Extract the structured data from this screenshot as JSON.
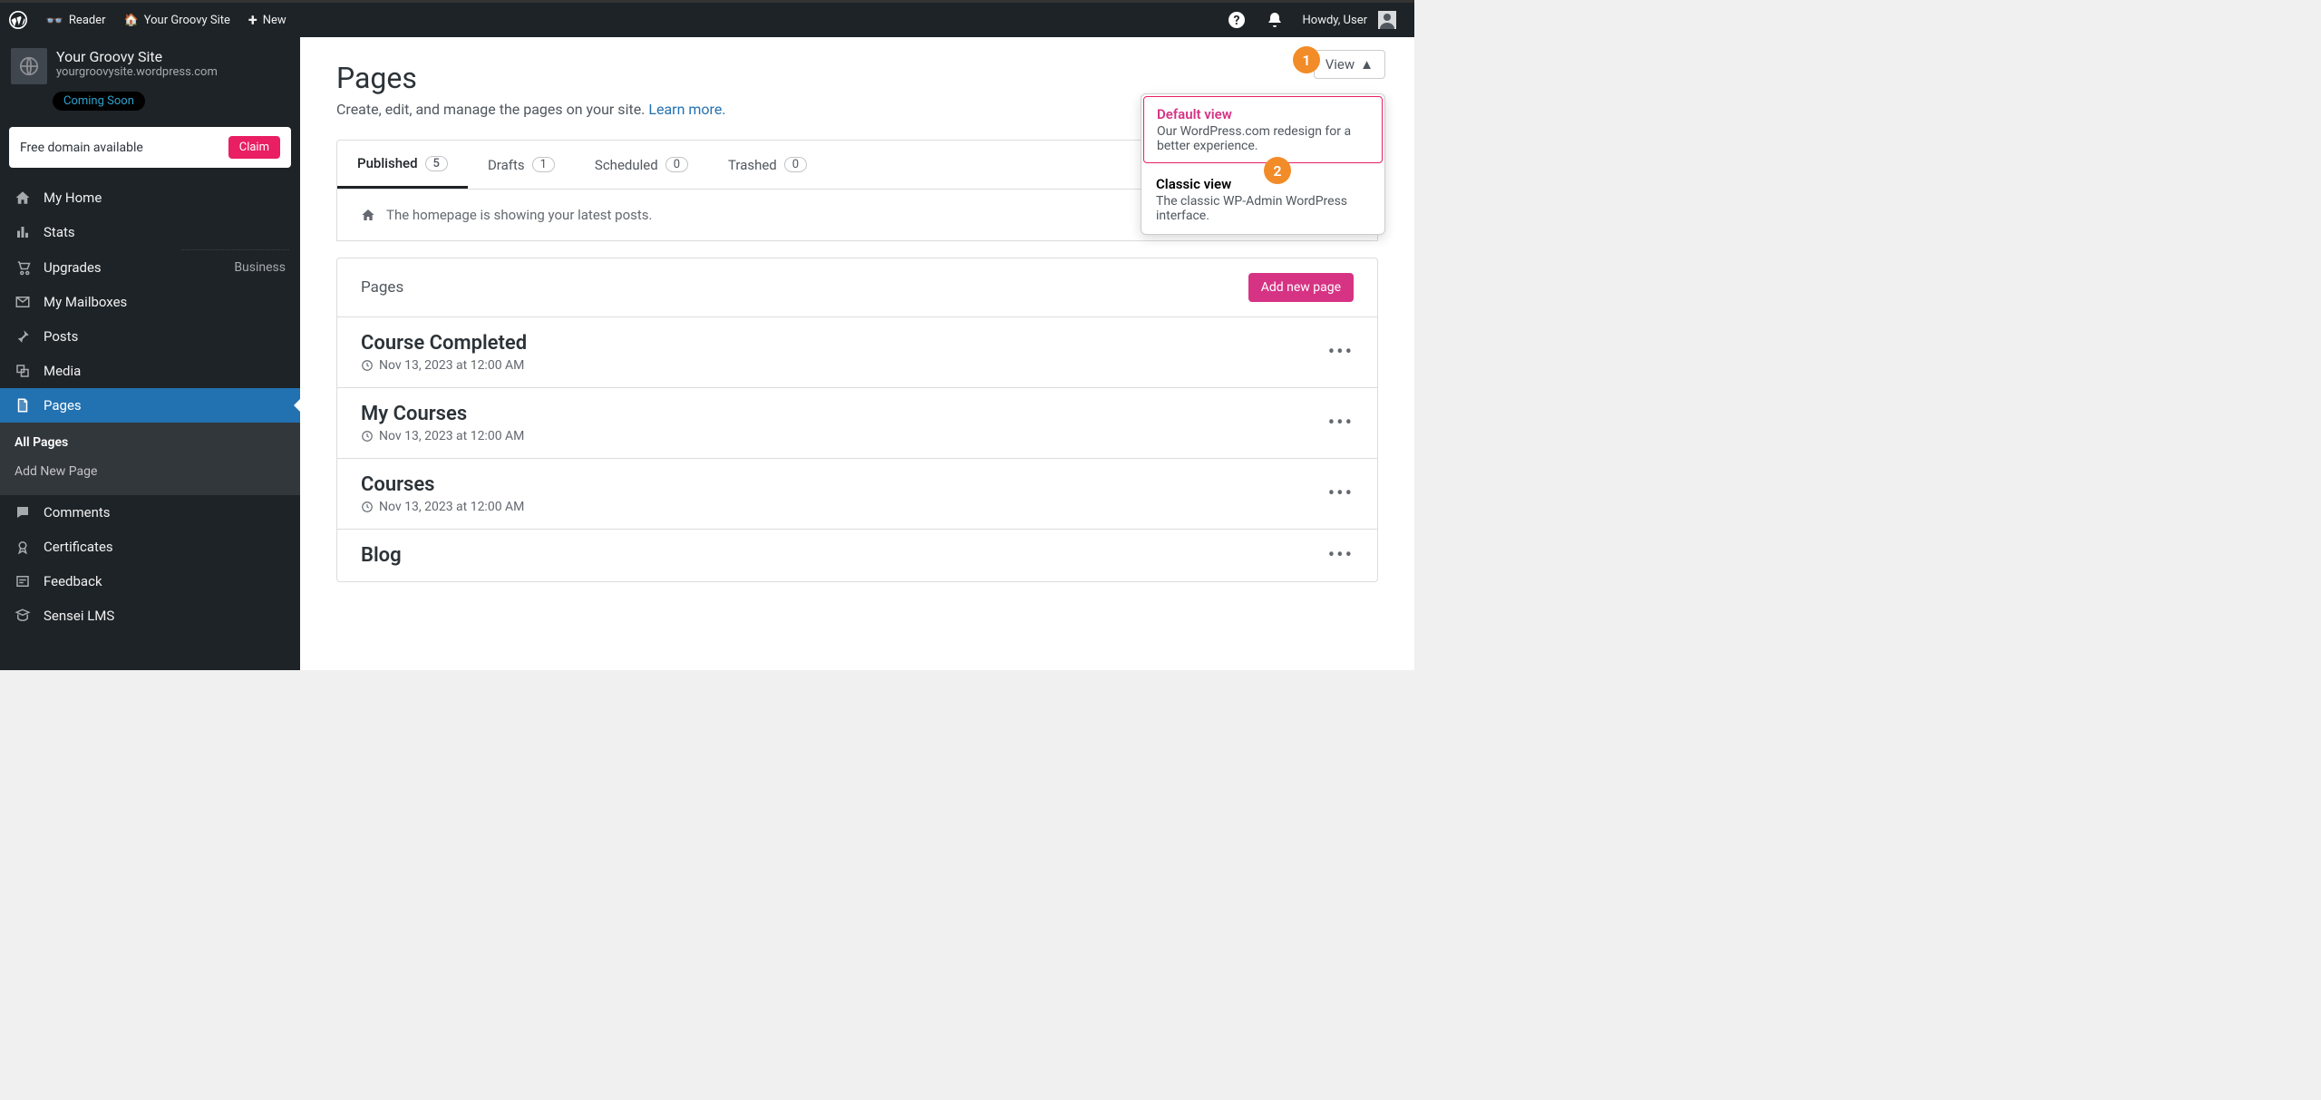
{
  "adminbar": {
    "reader": "Reader",
    "site_title": "Your Groovy Site",
    "new": "New",
    "howdy": "Howdy, User"
  },
  "site": {
    "name": "Your Groovy Site",
    "url": "yourgroovysite.wordpress.com",
    "status": "Coming Soon"
  },
  "domain_card": {
    "text": "Free domain available",
    "button": "Claim"
  },
  "sidebar": {
    "items": [
      {
        "label": "My Home",
        "icon": "home"
      },
      {
        "label": "Stats",
        "icon": "stats",
        "separator_after": true
      },
      {
        "label": "Upgrades",
        "icon": "cart",
        "side": "Business"
      },
      {
        "label": "My Mailboxes",
        "icon": "mail"
      },
      {
        "label": "Posts",
        "icon": "pin"
      },
      {
        "label": "Media",
        "icon": "media"
      },
      {
        "label": "Pages",
        "icon": "page",
        "active": true
      },
      {
        "label": "Comments",
        "icon": "comment"
      },
      {
        "label": "Certificates",
        "icon": "cert"
      },
      {
        "label": "Feedback",
        "icon": "feedback"
      },
      {
        "label": "Sensei LMS",
        "icon": "sensei"
      }
    ],
    "subnav": [
      {
        "label": "All Pages",
        "current": true
      },
      {
        "label": "Add New Page"
      }
    ]
  },
  "page": {
    "title": "Pages",
    "subtitle_pre": "Create, edit, and manage the pages on your site. ",
    "subtitle_link": "Learn more."
  },
  "view_button": "View",
  "view_options": [
    {
      "title": "Default view",
      "desc": "Our WordPress.com redesign for a better experience.",
      "selected": true
    },
    {
      "title": "Classic view",
      "desc": "The classic WP-Admin WordPress interface."
    }
  ],
  "steps": [
    "1",
    "2"
  ],
  "tabs": [
    {
      "label": "Published",
      "count": "5",
      "active": true
    },
    {
      "label": "Drafts",
      "count": "1"
    },
    {
      "label": "Scheduled",
      "count": "0"
    },
    {
      "label": "Trashed",
      "count": "0"
    }
  ],
  "banner": "The homepage is showing your latest posts.",
  "panel": {
    "title": "Pages",
    "add_button": "Add new page",
    "rows": [
      {
        "title": "Course Completed",
        "date": "Nov 13, 2023 at 12:00 AM"
      },
      {
        "title": "My Courses",
        "date": "Nov 13, 2023 at 12:00 AM"
      },
      {
        "title": "Courses",
        "date": "Nov 13, 2023 at 12:00 AM"
      },
      {
        "title": "Blog",
        "date": ""
      }
    ]
  }
}
